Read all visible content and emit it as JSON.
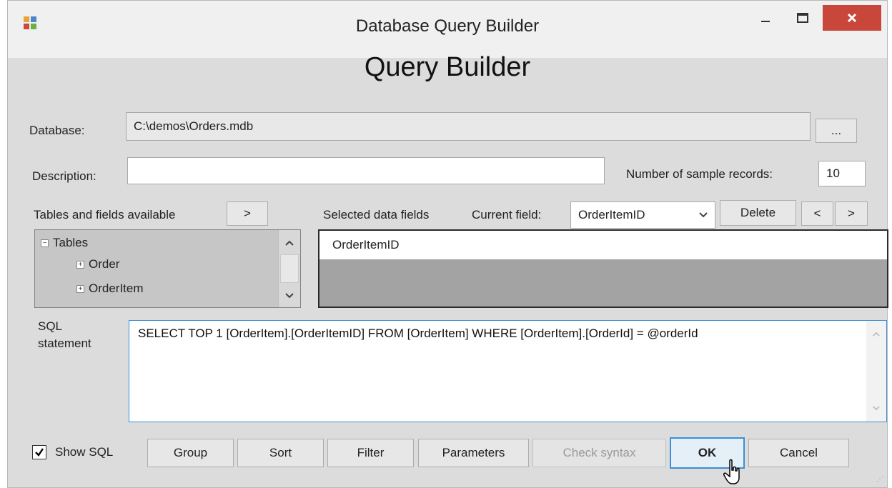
{
  "window": {
    "title": "Database Query Builder",
    "minimize_icon": "minimize-icon",
    "maximize_icon": "maximize-icon",
    "close_icon": "close-icon",
    "close_color": "#c9463b"
  },
  "heading": "Query Builder",
  "database": {
    "label": "Database:",
    "value": "C:\\demos\\Orders.mdb",
    "browse_label": "..."
  },
  "description": {
    "label": "Description:",
    "value": ""
  },
  "sample": {
    "label": "Number of sample records:",
    "value": "10"
  },
  "tables": {
    "label": "Tables and fields available",
    "add_label": ">",
    "root": "Tables",
    "items": [
      "Order",
      "OrderItem"
    ]
  },
  "selected": {
    "label": "Selected data fields",
    "current_label": "Current field:",
    "current_value": "OrderItemID",
    "delete_label": "Delete",
    "prev_label": "<",
    "next_label": ">",
    "fields": [
      "OrderItemID"
    ]
  },
  "sql": {
    "label_line1": "SQL",
    "label_line2": "statement",
    "text": "SELECT TOP 1 [OrderItem].[OrderItemID] FROM [OrderItem] WHERE [OrderItem].[OrderId] = @orderId"
  },
  "footer": {
    "show_sql_label": "Show SQL",
    "show_sql_checked": true,
    "group": "Group",
    "sort": "Sort",
    "filter": "Filter",
    "parameters": "Parameters",
    "check_syntax": "Check syntax",
    "ok": "OK",
    "cancel": "Cancel"
  },
  "accent_color": "#3a8fd6"
}
